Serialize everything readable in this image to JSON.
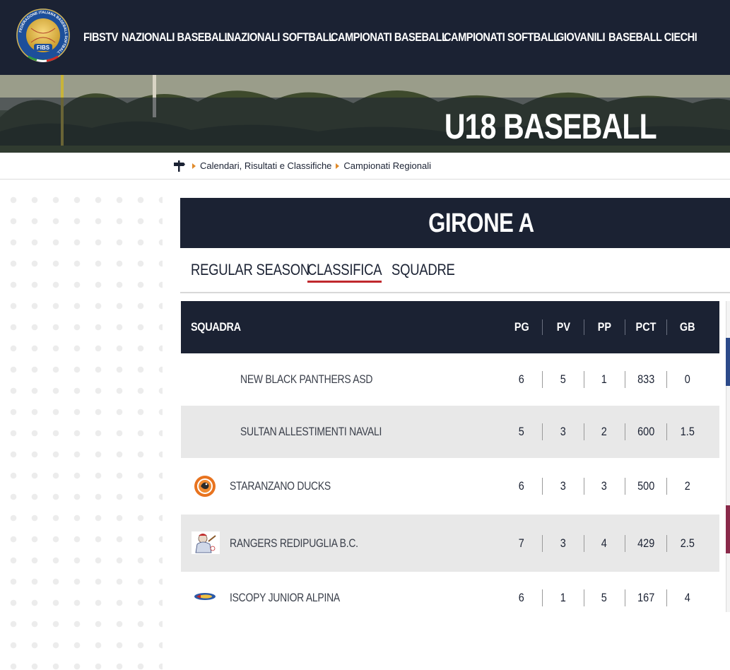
{
  "brand": {
    "logo_text": "FIBS",
    "logo_ring_text": "FEDERAZIONE ITALIANA BASEBALL SOFTBALL"
  },
  "nav": {
    "items": [
      {
        "label": "FIBSTV"
      },
      {
        "label": "NAZIONALI BASEBALL"
      },
      {
        "label": "NAZIONALI SOFTBALL"
      },
      {
        "label": "CAMPIONATI BASEBALL"
      },
      {
        "label": "CAMPIONATI SOFTBALL"
      },
      {
        "label": "GIOVANILI"
      },
      {
        "label": "BASEBALL CIECHI"
      }
    ]
  },
  "hero": {
    "title": "U18 BASEBALL"
  },
  "breadcrumb": {
    "items": [
      {
        "label": "Calendari, Risultati e Classifiche"
      },
      {
        "label": "Campionati Regionali"
      }
    ]
  },
  "group": {
    "title": "GIRONE A"
  },
  "tabs": [
    {
      "label": "REGULAR SEASON",
      "active": false
    },
    {
      "label": "CLASSIFICA",
      "active": true
    },
    {
      "label": "SQUADRE",
      "active": false
    }
  ],
  "standings": {
    "headers": {
      "team": "SQUADRA",
      "pg": "PG",
      "pv": "PV",
      "pp": "PP",
      "pct": "PCT",
      "gb": "GB"
    },
    "rows": [
      {
        "team": "NEW BLACK PANTHERS ASD",
        "logo": "none",
        "pg": "6",
        "pv": "5",
        "pp": "1",
        "pct": "833",
        "gb": "0"
      },
      {
        "team": "SULTAN ALLESTIMENTI NAVALI",
        "logo": "none",
        "pg": "5",
        "pv": "3",
        "pp": "2",
        "pct": "600",
        "gb": "1.5"
      },
      {
        "team": "STARANZANO DUCKS",
        "logo": "ducks-logo",
        "pg": "6",
        "pv": "3",
        "pp": "3",
        "pct": "500",
        "gb": "2"
      },
      {
        "team": "RANGERS REDIPUGLIA B.C.",
        "logo": "rangers-logo",
        "pg": "7",
        "pv": "3",
        "pp": "4",
        "pct": "429",
        "gb": "2.5"
      },
      {
        "team": "ISCOPY JUNIOR ALPINA",
        "logo": "alpina-logo",
        "pg": "6",
        "pv": "1",
        "pp": "5",
        "pct": "167",
        "gb": "4"
      }
    ]
  },
  "colors": {
    "navy": "#1b2233",
    "accent_red": "#c0282d",
    "breadcrumb_arrow": "#e08a2a",
    "row_alt": "#e8e8e8"
  }
}
